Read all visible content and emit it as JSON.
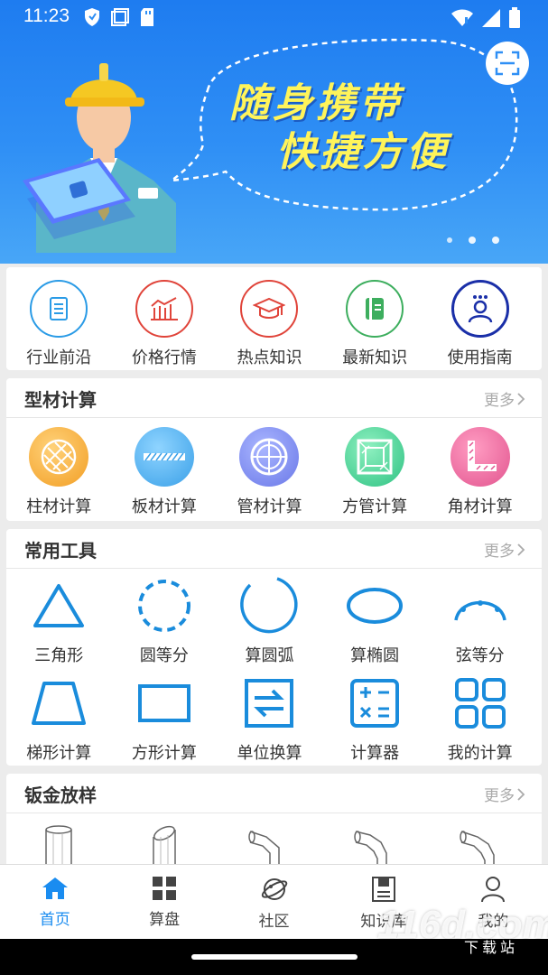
{
  "status": {
    "time": "11:23"
  },
  "banner": {
    "line1": "随身携带",
    "line2": "快捷方便"
  },
  "quick_nav": [
    {
      "label": "行业前沿",
      "icon": "document-list-icon",
      "color": "#2a9be6"
    },
    {
      "label": "价格行情",
      "icon": "bar-chart-icon",
      "color": "#e0443a"
    },
    {
      "label": "热点知识",
      "icon": "graduation-cap-icon",
      "color": "#e0443a"
    },
    {
      "label": "最新知识",
      "icon": "notebook-icon",
      "color": "#3dae5e"
    },
    {
      "label": "使用指南",
      "icon": "person-guide-icon",
      "color": "#1a2fa8"
    }
  ],
  "profile_calc": {
    "title": "型材计算",
    "more": "更多",
    "items": [
      {
        "label": "柱材计算",
        "icon": "round-bar-icon",
        "color": "#f5a623"
      },
      {
        "label": "板材计算",
        "icon": "plate-icon",
        "color": "#3aa0e8"
      },
      {
        "label": "管材计算",
        "icon": "pipe-icon",
        "color": "#6a78e8"
      },
      {
        "label": "方管计算",
        "icon": "square-tube-icon",
        "color": "#3fd08f"
      },
      {
        "label": "角材计算",
        "icon": "angle-steel-icon",
        "color": "#e2558f"
      }
    ]
  },
  "common_tools": {
    "title": "常用工具",
    "more": "更多",
    "row1": [
      {
        "label": "三角形",
        "icon": "triangle-icon"
      },
      {
        "label": "圆等分",
        "icon": "dashed-circle-icon"
      },
      {
        "label": "算圆弧",
        "icon": "arc-icon"
      },
      {
        "label": "算椭圆",
        "icon": "ellipse-icon"
      },
      {
        "label": "弦等分",
        "icon": "chord-icon"
      }
    ],
    "row2": [
      {
        "label": "梯形计算",
        "icon": "trapezoid-icon"
      },
      {
        "label": "方形计算",
        "icon": "rectangle-icon"
      },
      {
        "label": "单位换算",
        "icon": "swap-arrows-icon"
      },
      {
        "label": "计算器",
        "icon": "calculator-icon"
      },
      {
        "label": "我的计算",
        "icon": "grid-squares-icon"
      }
    ],
    "accent": "#1a8cdc"
  },
  "sheet_metal": {
    "title": "钣金放样",
    "more": "更多"
  },
  "tabs": [
    {
      "label": "首页",
      "icon": "home-icon",
      "active": true
    },
    {
      "label": "算盘",
      "icon": "apps-grid-icon",
      "active": false
    },
    {
      "label": "社区",
      "icon": "planet-icon",
      "active": false
    },
    {
      "label": "知识库",
      "icon": "book-icon",
      "active": false
    },
    {
      "label": "我的",
      "icon": "user-icon",
      "active": false
    }
  ],
  "watermark": {
    "main": "116d.com",
    "sub": "下载站"
  }
}
